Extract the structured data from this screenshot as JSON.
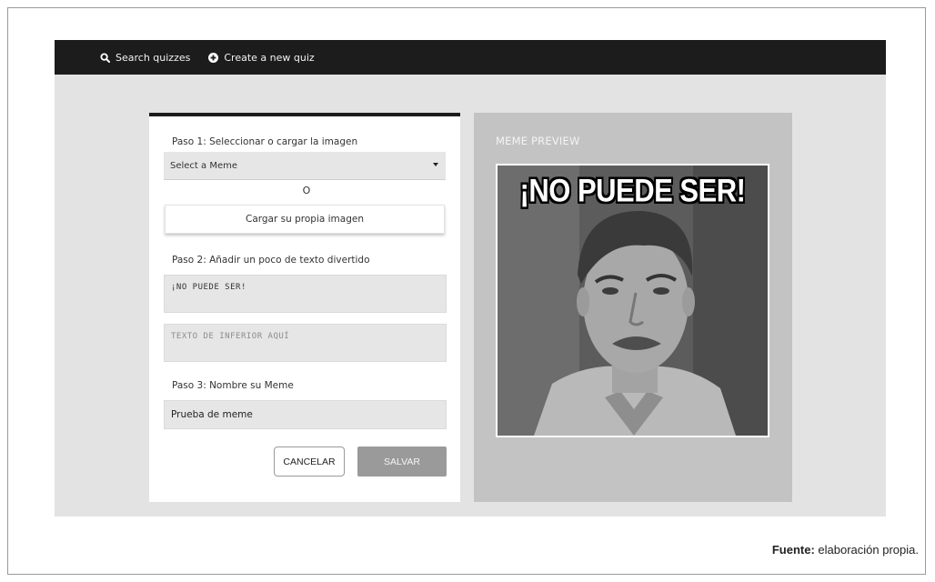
{
  "nav": {
    "search_label": "Search quizzes",
    "create_label": "Create a new quiz"
  },
  "form": {
    "step1_label": "Paso 1: Seleccionar o cargar la imagen",
    "select_value": "Select a Meme",
    "or_text": "O",
    "upload_button": "Cargar su propia imagen",
    "step2_label": "Paso 2: Añadir un poco de texto divertido",
    "top_text_value": "¡NO PUEDE SER!",
    "bottom_text_placeholder": "TEXTO DE INFERIOR AQUÍ",
    "step3_label": "Paso 3: Nombre su Meme",
    "name_value": "Prueba de meme",
    "cancel_button": "CANCELAR",
    "save_button": "SALVAR"
  },
  "preview": {
    "title": "MEME PREVIEW",
    "caption": "¡NO PUEDE SER!"
  },
  "footer": {
    "source_label": "Fuente:",
    "source_text": "elaboración propia."
  },
  "colors": {
    "topbar": "#1c1c1c",
    "preview_panel": "#c3c3c3",
    "save_button": "#9a9a9a"
  },
  "icons": {
    "search": "search-icon",
    "create": "plus-circle-icon",
    "select": "caret-down-icon"
  }
}
